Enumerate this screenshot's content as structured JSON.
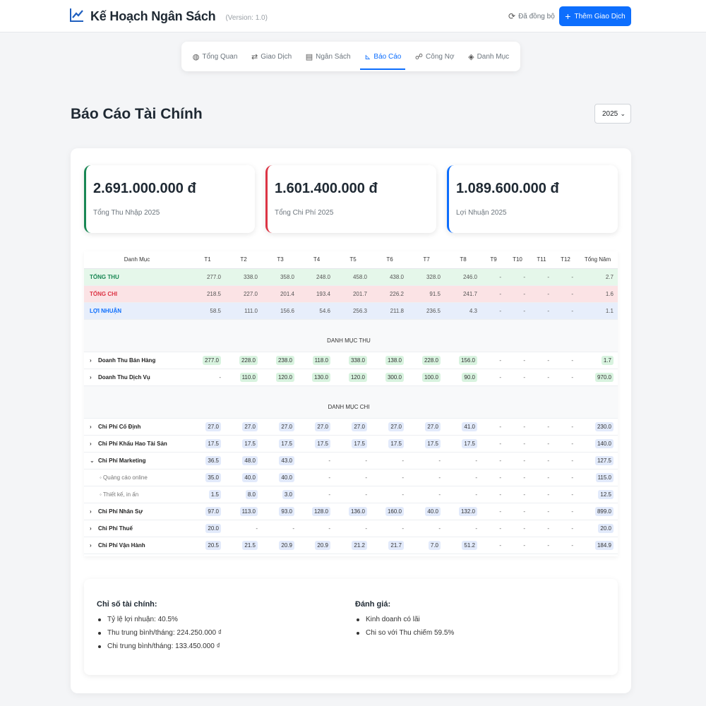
{
  "app": {
    "title": "Kế Hoạch Ngân Sách",
    "version": "(Version: 1.0)",
    "sync_status": "Đã đồng bộ",
    "add_button": "Thêm Giao Dịch",
    "accent": "#0d6efd"
  },
  "tabs": [
    {
      "label": "Tổng Quan",
      "icon": "dashboard-icon"
    },
    {
      "label": "Giao Dịch",
      "icon": "exchange-icon"
    },
    {
      "label": "Ngân Sách",
      "icon": "calculator-icon"
    },
    {
      "label": "Báo Cáo",
      "icon": "chart-icon",
      "active": true
    },
    {
      "label": "Công Nợ",
      "icon": "handshake-icon"
    },
    {
      "label": "Danh Mục",
      "icon": "tags-icon"
    }
  ],
  "page": {
    "title": "Báo Cáo Tài Chính",
    "year": "2025"
  },
  "cards": [
    {
      "amount": "2.691.000.000 đ",
      "label": "Tổng Thu Nhập 2025",
      "color": "#198754"
    },
    {
      "amount": "1.601.400.000 đ",
      "label": "Tổng Chi Phí 2025",
      "color": "#dc3545"
    },
    {
      "amount": "1.089.600.000 đ",
      "label": "Lợi Nhuận 2025",
      "color": "#0d6efd"
    }
  ],
  "table": {
    "headers": [
      "Danh Mục",
      "T1",
      "T2",
      "T3",
      "T4",
      "T5",
      "T6",
      "T7",
      "T8",
      "T9",
      "T10",
      "T11",
      "T12",
      "Tổng Năm"
    ],
    "summary_rows": [
      {
        "name": "TỔNG THU",
        "values": [
          "277.0",
          "338.0",
          "358.0",
          "248.0",
          "458.0",
          "438.0",
          "328.0",
          "246.0",
          "-",
          "-",
          "-",
          "-",
          "2.7"
        ]
      },
      {
        "name": "TỔNG CHI",
        "values": [
          "218.5",
          "227.0",
          "201.4",
          "193.4",
          "201.7",
          "226.2",
          "91.5",
          "241.7",
          "-",
          "-",
          "-",
          "-",
          "1.6"
        ]
      },
      {
        "name": "LỢI NHUẬN",
        "values": [
          "58.5",
          "111.0",
          "156.6",
          "54.6",
          "256.3",
          "211.8",
          "236.5",
          "4.3",
          "-",
          "-",
          "-",
          "-",
          "1.1"
        ]
      }
    ],
    "income_section": "DANH MỤC THU",
    "income_rows": [
      {
        "name": "Doanh Thu Bán Hàng",
        "values": [
          "277.0",
          "228.0",
          "238.0",
          "118.0",
          "338.0",
          "138.0",
          "228.0",
          "156.0",
          "-",
          "-",
          "-",
          "-",
          "1.7"
        ]
      },
      {
        "name": "Doanh Thu Dịch Vụ",
        "values": [
          "-",
          "110.0",
          "120.0",
          "130.0",
          "120.0",
          "300.0",
          "100.0",
          "90.0",
          "-",
          "-",
          "-",
          "-",
          "970.0"
        ]
      }
    ],
    "expense_section": "DANH MỤC CHI",
    "expense_rows": [
      {
        "name": "Chi Phí Cố Định",
        "values": [
          "27.0",
          "27.0",
          "27.0",
          "27.0",
          "27.0",
          "27.0",
          "27.0",
          "41.0",
          "-",
          "-",
          "-",
          "-",
          "230.0"
        ]
      },
      {
        "name": "Chi Phí Khấu Hao Tài Sản",
        "values": [
          "17.5",
          "17.5",
          "17.5",
          "17.5",
          "17.5",
          "17.5",
          "17.5",
          "17.5",
          "-",
          "-",
          "-",
          "-",
          "140.0"
        ]
      },
      {
        "name": "Chi Phí Marketing",
        "expanded": true,
        "values": [
          "36.5",
          "48.0",
          "43.0",
          "-",
          "-",
          "-",
          "-",
          "-",
          "-",
          "-",
          "-",
          "-",
          "127.5"
        ]
      },
      {
        "name": "◦ Quảng cáo online",
        "sub": true,
        "values": [
          "35.0",
          "40.0",
          "40.0",
          "-",
          "-",
          "-",
          "-",
          "-",
          "-",
          "-",
          "-",
          "-",
          "115.0"
        ]
      },
      {
        "name": "◦ Thiết kế, in ấn",
        "sub": true,
        "values": [
          "1.5",
          "8.0",
          "3.0",
          "-",
          "-",
          "-",
          "-",
          "-",
          "-",
          "-",
          "-",
          "-",
          "12.5"
        ]
      },
      {
        "name": "Chi Phí Nhân Sự",
        "values": [
          "97.0",
          "113.0",
          "93.0",
          "128.0",
          "136.0",
          "160.0",
          "40.0",
          "132.0",
          "-",
          "-",
          "-",
          "-",
          "899.0"
        ]
      },
      {
        "name": "Chi Phí Thuế",
        "values": [
          "20.0",
          "-",
          "-",
          "-",
          "-",
          "-",
          "-",
          "-",
          "-",
          "-",
          "-",
          "-",
          "20.0"
        ]
      },
      {
        "name": "Chi Phí Vận Hành",
        "values": [
          "20.5",
          "21.5",
          "20.9",
          "20.9",
          "21.2",
          "21.7",
          "7.0",
          "51.2",
          "-",
          "-",
          "-",
          "-",
          "184.9"
        ]
      }
    ]
  },
  "summary": {
    "left_title": "Chỉ số tài chính:",
    "left_items": [
      "Tỷ lệ lợi nhuận: 40.5%",
      "Thu trung bình/tháng: 224.250.000 ₫",
      "Chi trung bình/tháng: 133.450.000 ₫"
    ],
    "right_title": "Đánh giá:",
    "right_items": [
      "Kinh doanh có lãi",
      "Chi so với Thu chiếm 59.5%"
    ]
  }
}
